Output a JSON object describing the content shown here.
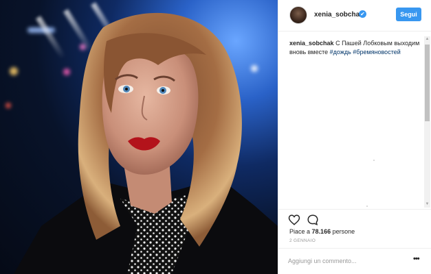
{
  "post": {
    "image_alt": "Selfie photo of a woman with wavy hair and red lipstick"
  },
  "header": {
    "username": "xenia_sobchak",
    "verified_mark": "✔",
    "follow_label": "Segui"
  },
  "caption": {
    "user": "xenia_sobchak",
    "text": "С Пашей Лобковым выходим вновь вместе",
    "tag1": "#дождь",
    "tag2": "#бремяновостей"
  },
  "actions": {
    "likes_prefix": "Piace a",
    "likes_count": "78.166",
    "likes_suffix": "persone"
  },
  "date": "2 GENNAIO",
  "comment": {
    "placeholder": "Aggiungi un commento...",
    "more_label": "•••"
  },
  "colors": {
    "accent": "#3897f0",
    "text": "#262626",
    "muted": "#999999",
    "hashtag": "#003569",
    "lips": "#b3131b"
  },
  "icons": {
    "like": "heart-outline-icon",
    "comment": "speech-bubble-icon",
    "verified": "verified-badge-icon"
  }
}
